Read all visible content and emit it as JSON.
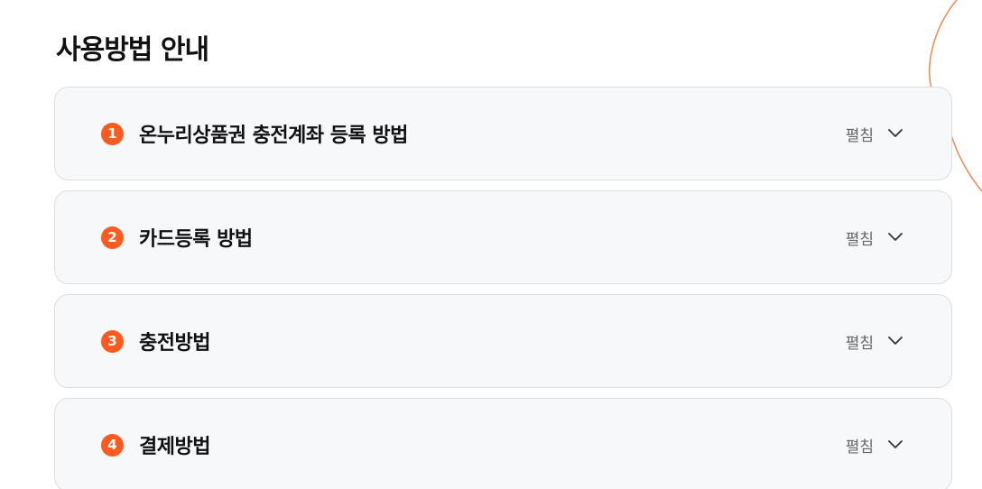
{
  "section": {
    "title": "사용방법 안내"
  },
  "colors": {
    "accent": "#ff5a1f",
    "decor_line": "#f0894f"
  },
  "accordion": {
    "items": [
      {
        "number": "1",
        "title": "온누리상품권 충전계좌 등록 방법",
        "toggle_label": "펼침",
        "toggle_icon": "chevron-down-icon"
      },
      {
        "number": "2",
        "title": "카드등록 방법",
        "toggle_label": "펼침",
        "toggle_icon": "chevron-down-icon"
      },
      {
        "number": "3",
        "title": "충전방법",
        "toggle_label": "펼침",
        "toggle_icon": "chevron-down-icon"
      },
      {
        "number": "4",
        "title": "결제방법",
        "toggle_label": "펼침",
        "toggle_icon": "chevron-down-icon"
      }
    ]
  }
}
